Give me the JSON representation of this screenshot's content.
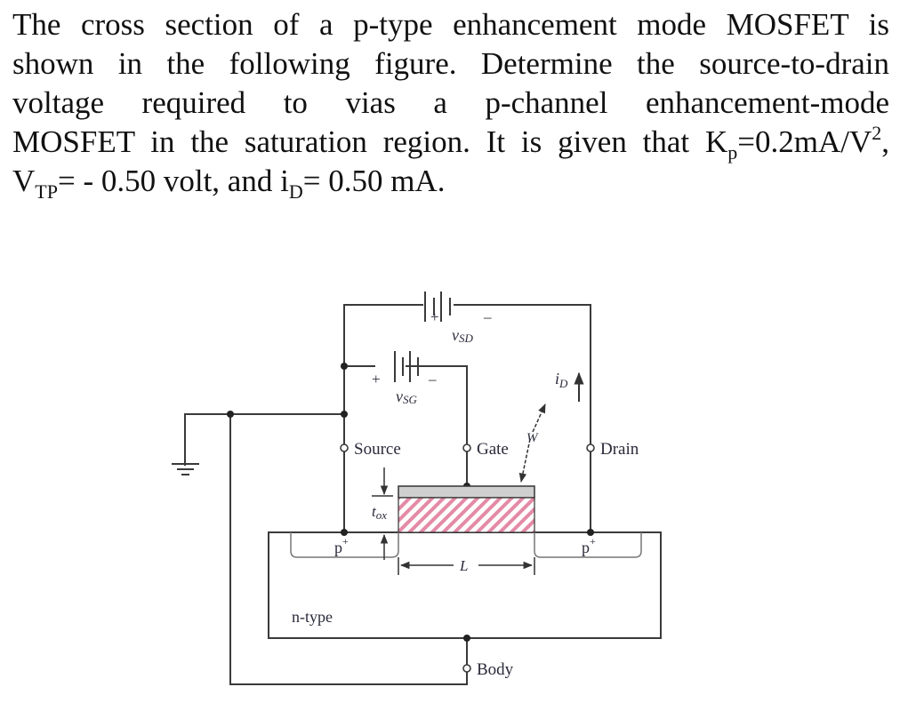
{
  "question": {
    "line1": "The cross section of a p-type enhancement mode MOSFET is",
    "line2": "shown in the following figure. Determine the source-to-drain",
    "line3": "voltage required to vias a p-channel enhancement-mode",
    "line4_prefix": "MOSFET in the saturation region. It is given that K",
    "kp_sub": "p",
    "line4_value": "=0.2mA/V",
    "line4_sup": "2",
    "line4_suffix": ",",
    "vtp_symbol": "V",
    "vtp_sub": "TP",
    "vtp_value": "= - 0.50 volt, and i",
    "id_sub": "D",
    "id_value": "= 0.50 mA."
  },
  "figure": {
    "labels": {
      "vsd_main": "v",
      "vsd_sub": "SD",
      "vsg_main": "v",
      "vsg_sub": "SG",
      "id_main": "i",
      "id_sub": "D",
      "plus": "+",
      "minus": "–",
      "source": "Source",
      "gate": "Gate",
      "drain": "Drain",
      "body": "Body",
      "w": "W",
      "l": "L",
      "tox_main": "t",
      "tox_sub": "ox",
      "p_plus_left": "p",
      "p_plus_right": "p",
      "plus_sup": "+",
      "substrate": "n-type"
    },
    "colors": {
      "wire": "#3a3a3a",
      "gate_metal": "#cfcfcf",
      "oxide_hatch": "#e48aa6",
      "label_text": "#2a2a3a"
    }
  }
}
